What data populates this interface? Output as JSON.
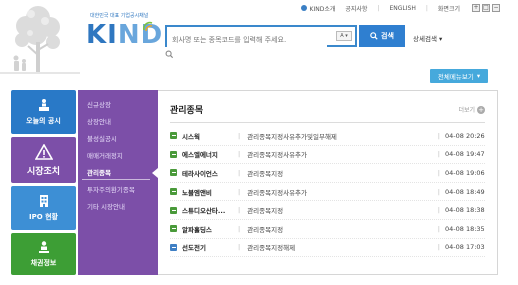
{
  "util": {
    "kind_intro": "KIND소개",
    "notice": "공지사항",
    "english": "ENGLISH",
    "zoom_label": "화면크기",
    "zoom_buttons": [
      "+",
      "□",
      "−"
    ]
  },
  "logo": {
    "tagline": "대한민국 대표 기업공시채널",
    "word_a": "KI",
    "word_b": "ND"
  },
  "search": {
    "placeholder": "회사명 또는 종목코드를 입력해 주세요.",
    "select_value": "A",
    "button_label": "검색",
    "advanced_label": "상세검색"
  },
  "all_menu_label": "전체메뉴보기",
  "big_tabs": [
    {
      "label": "오늘의 공시"
    },
    {
      "label": "시장조치"
    },
    {
      "label": "IPO 현황"
    },
    {
      "label": "채권정보"
    }
  ],
  "submenu": {
    "items": [
      {
        "label": "신규상장"
      },
      {
        "label": "상장안내"
      },
      {
        "label": "불성실공시"
      },
      {
        "label": "매매거래정지"
      },
      {
        "label": "관리종목"
      },
      {
        "label": "투자주의환기종목"
      },
      {
        "label": "기타 시장안내"
      }
    ],
    "active_index": 4
  },
  "panel": {
    "title": "관리종목",
    "more_label": "더보기",
    "rows": [
      {
        "company": "시스웍",
        "reason": "관리종목지정사유추가및일부해제",
        "date": "04-08 20:26",
        "icon": "g"
      },
      {
        "company": "에스엘에너지",
        "reason": "관리종목지정사유추가",
        "date": "04-08 19:47",
        "icon": "g"
      },
      {
        "company": "테라사이언스",
        "reason": "관리종목지정",
        "date": "04-08 19:06",
        "icon": "g"
      },
      {
        "company": "노블엠앤비",
        "reason": "관리종목지정사유추가",
        "date": "04-08 18:49",
        "icon": "g"
      },
      {
        "company": "스튜디오산타...",
        "reason": "관리종목지정",
        "date": "04-08 18:38",
        "icon": "g"
      },
      {
        "company": "알파홀딩스",
        "reason": "관리종목지정",
        "date": "04-08 18:35",
        "icon": "g"
      },
      {
        "company": "선도전기",
        "reason": "관리종목지정해제",
        "date": "04-08 17:03",
        "icon": "b"
      }
    ]
  },
  "colors": {
    "brand_blue": "#2f77c0",
    "market_purple": "#7c4fa8",
    "ipo_blue": "#3d8fd5",
    "bond_green": "#3d9e35",
    "all_menu": "#46a9dc"
  }
}
